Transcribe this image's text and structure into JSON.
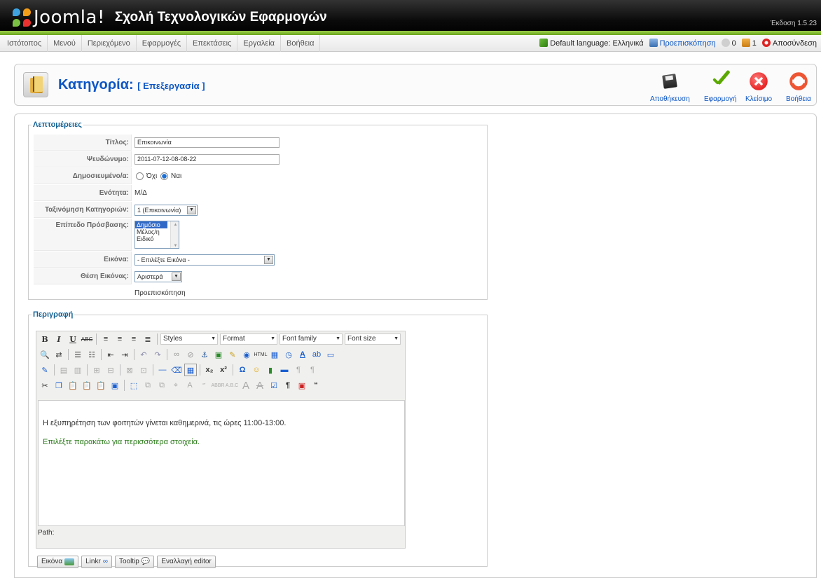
{
  "header": {
    "logo_text": "Joomla!",
    "site_name": "Σχολή Τεχνολογικών Εφαρμογών",
    "version": "Έκδοση 1.5.23"
  },
  "menu": {
    "items": [
      "Ιστότοπος",
      "Μενού",
      "Περιεχόμενο",
      "Εφαρμογές",
      "Επεκτάσεις",
      "Εργαλεία",
      "Βοήθεια"
    ]
  },
  "status": {
    "language": "Default language: Ελληνικά",
    "preview": "Προεπισκόπηση",
    "messages_count": "0",
    "users_count": "1",
    "logout": "Αποσύνδεση"
  },
  "toolbar": {
    "title": "Κατηγορία:",
    "subtitle": "[ Επεξεργασία ]",
    "save": "Αποθήκευση",
    "apply": "Εφαρμογή",
    "close": "Κλείσιμο",
    "help": "Βοήθεια"
  },
  "details": {
    "legend": "Λεπτομέρειες",
    "title_label": "Τίτλος:",
    "title_value": "Επικοινωνία",
    "alias_label": "Ψευδώνυμο:",
    "alias_value": "2011-07-12-08-08-22",
    "published_label": "Δημοσιευμένο/α:",
    "published_no": "Όχι",
    "published_yes": "Ναι",
    "published_value": "Ναι",
    "section_label": "Ενότητα:",
    "section_value": "Μ/Δ",
    "order_label": "Ταξινόμηση Κατηγοριών:",
    "order_value": "1 (Επικοινωνία)",
    "access_label": "Επίπεδο Πρόσβασης:",
    "access_options": [
      "Δημόσιο",
      "Μέλος/η",
      "Ειδικό"
    ],
    "access_selected": "Δημόσιο",
    "image_label": "Εικόνα:",
    "image_value": "- Επιλέξτε Εικόνα -",
    "image_pos_label": "Θέση Εικόνας:",
    "image_pos_value": "Αριστερά",
    "preview_text": "Προεπισκόπηση"
  },
  "description": {
    "legend": "Περιγραφή",
    "styles": "Styles",
    "format": "Format",
    "font_family": "Font family",
    "font_size": "Font size",
    "paragraph1": "Η εξυπηρέτηση των φοιτητών γίνεται καθημερινά, τις ώρες 11:00-13:00.",
    "paragraph2": "Επιλέξτε παρακάτω για περισσότερα στοιχεία.",
    "paragraph2_color": "#2a7a19",
    "path_label": "Path:",
    "buttons": {
      "image": "Εικόνα",
      "linkr": "Linkr",
      "tooltip": "Tooltip",
      "toggle": "Εναλλαγή editor"
    }
  },
  "colors": {
    "link_blue": "#0b55c4",
    "legend_blue": "#146295",
    "header_green": "#7ab62c"
  }
}
